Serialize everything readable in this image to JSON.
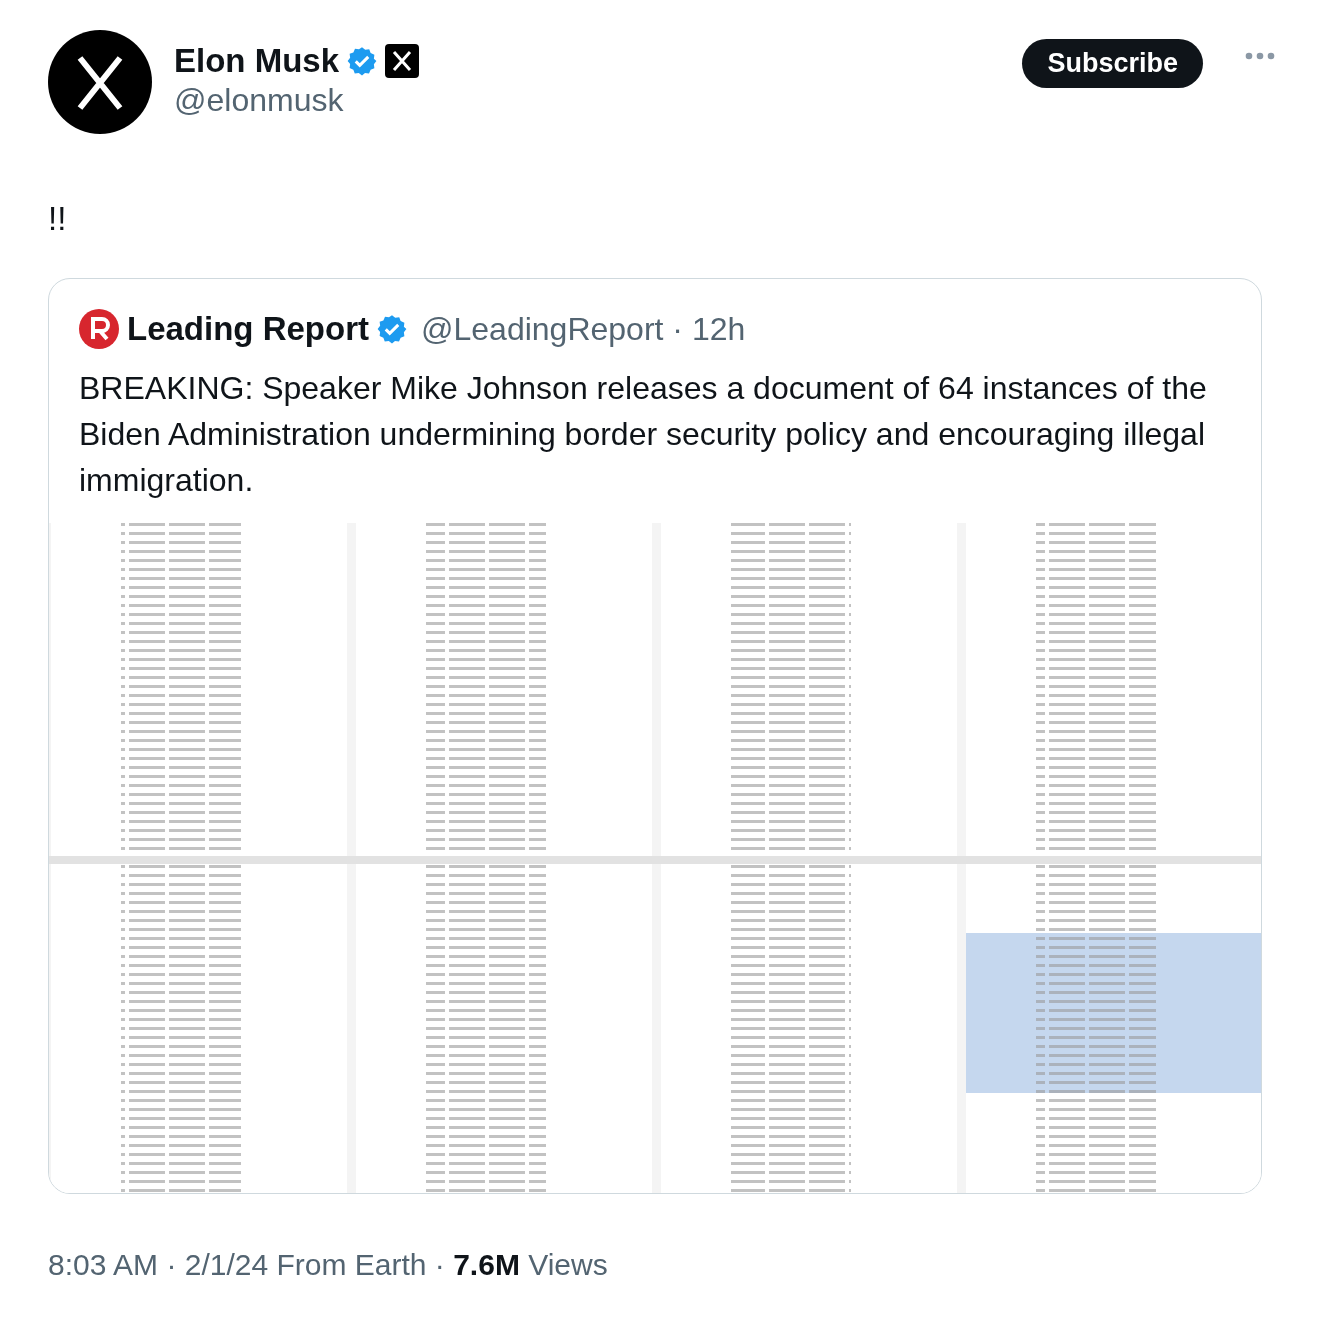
{
  "author": {
    "name": "Elon Musk",
    "handle": "@elonmusk",
    "verified": true
  },
  "subscribe": "Subscribe",
  "text": "!!",
  "quote": {
    "name": "Leading Report",
    "verified": true,
    "meta": "@LeadingReport · 12h",
    "text": "BREAKING: Speaker Mike Johnson releases a document of 64 instances of the Biden Administration undermining border security policy and encouraging illegal immigration."
  },
  "footer": "8:03 AM · 2/1/24 From Earth · **7.6M** Views"
}
